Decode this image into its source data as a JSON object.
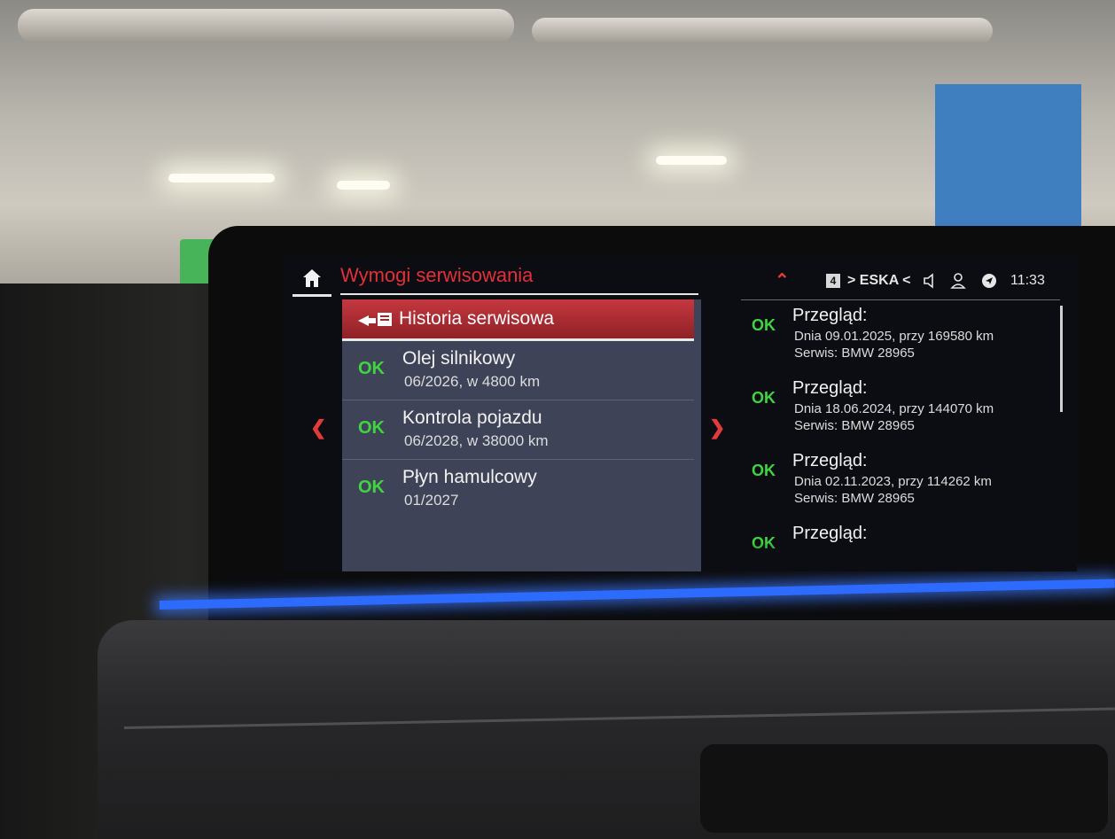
{
  "header": {
    "title": "Wymogi serwisowania"
  },
  "status_bar": {
    "radio_preset": "4",
    "radio_station": "> ESKA <",
    "time": "11:33"
  },
  "menu": {
    "history_label": "Historia serwisowa",
    "items": [
      {
        "status": "OK",
        "name": "Olej silnikowy",
        "detail": "06/2026, w 4800 km"
      },
      {
        "status": "OK",
        "name": "Kontrola pojazdu",
        "detail": "06/2028, w 38000 km"
      },
      {
        "status": "OK",
        "name": "Płyn hamulcowy",
        "detail": "01/2027"
      }
    ]
  },
  "history": [
    {
      "status": "OK",
      "type": "Przegląd:",
      "date": "Dnia 09.01.2025, przy 169580 km",
      "service": "Serwis: BMW 28965"
    },
    {
      "status": "OK",
      "type": "Przegląd:",
      "date": "Dnia 18.06.2024, przy 144070 km",
      "service": "Serwis: BMW 28965"
    },
    {
      "status": "OK",
      "type": "Przegląd:",
      "date": "Dnia 02.11.2023, przy 114262 km",
      "service": "Serwis: BMW 28965"
    },
    {
      "status": "OK",
      "type": "Przegląd:"
    }
  ],
  "icons": {
    "home": "home-icon",
    "history": "service-history-icon",
    "left": "chevron-left-icon",
    "right": "chevron-right-icon",
    "up": "chevron-up-icon",
    "speaker": "speaker-icon",
    "person": "person-icon",
    "nav": "navigation-icon"
  },
  "colors": {
    "accent": "#e2303a",
    "ok": "#40d440",
    "menu_bg": "#3f4358",
    "screen_bg": "#0b0d12",
    "ambient": "#2d6bff"
  }
}
